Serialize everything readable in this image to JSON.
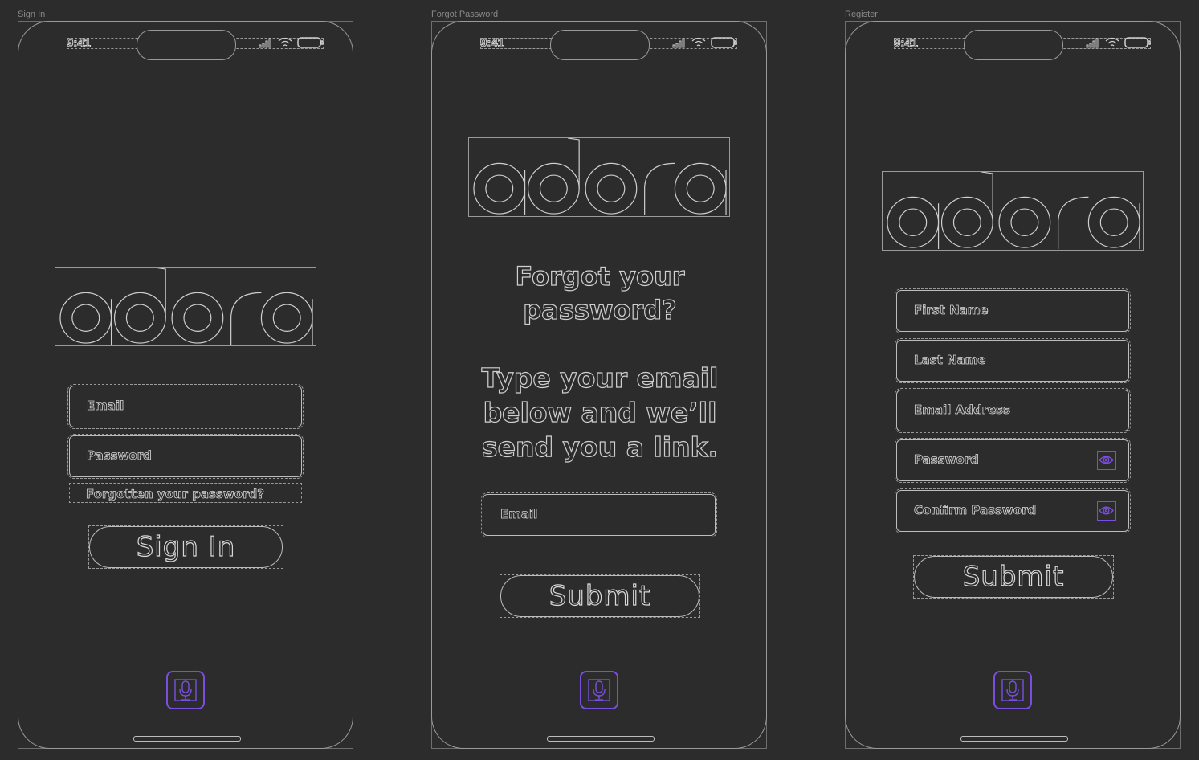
{
  "frames": {
    "signin": {
      "label": "Sign In",
      "time": "9:41",
      "email_label": "Email",
      "password_label": "Password",
      "forgot_link": "Forgotten your password?",
      "signin_button": "Sign In"
    },
    "forgot": {
      "label": "Forgot Password",
      "time": "9:41",
      "heading": "Forgot your password?",
      "instructions": "Type your email below and we’ll send you a link.",
      "email_label": "Email",
      "submit_button": "Submit"
    },
    "register": {
      "label": "Register",
      "time": "9:41",
      "first_name_label": "First Name",
      "last_name_label": "Last Name",
      "email_label": "Email Address",
      "password_label": "Password",
      "confirm_password_label": "Confirm Password",
      "submit_button": "Submit"
    }
  },
  "brand": {
    "logo_text": "adora",
    "accent_color": "#7b4ee0",
    "outline_color": "#cfcfcf",
    "background_color": "#2c2c2c"
  },
  "icons": {
    "mic": "microphone-icon",
    "eye": "eye-icon",
    "signal": "signal-icon",
    "wifi": "wifi-icon",
    "battery": "battery-icon"
  }
}
